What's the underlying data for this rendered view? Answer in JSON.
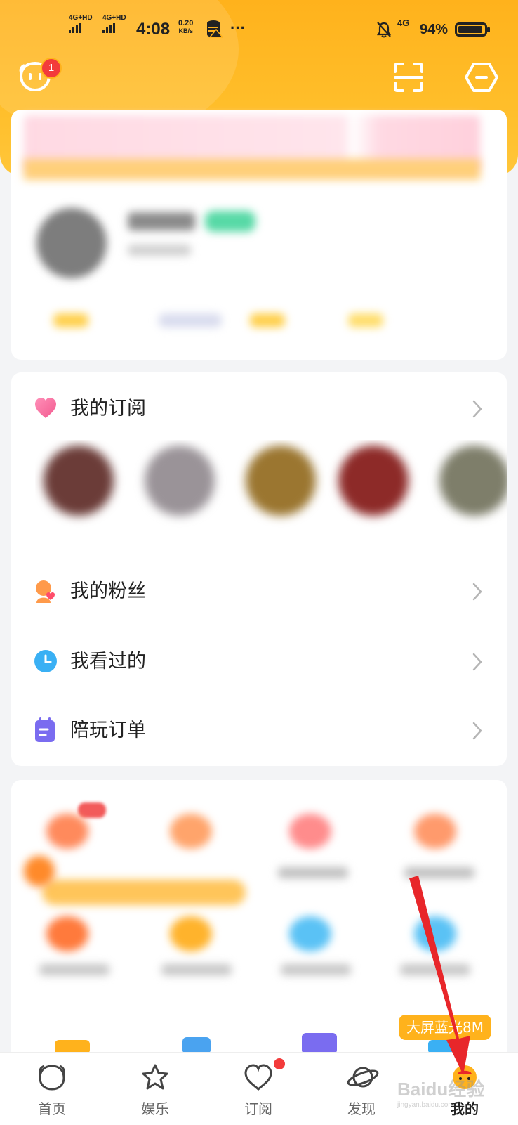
{
  "status_bar": {
    "network_1": "4G+HD",
    "network_2": "4G+HD",
    "time": "4:08",
    "speed_value": "0.20",
    "speed_unit": "KB/s",
    "dots": "···",
    "cellular": "4G",
    "battery_percent": "94%",
    "battery_level": 0.94
  },
  "header": {
    "message_badge": "1"
  },
  "menu": {
    "subscriptions": "我的订阅",
    "fans": "我的粉丝",
    "history": "我看过的",
    "orders": "陪玩订单"
  },
  "promo_tag": "大屏蓝光8M",
  "tabbar": {
    "home": "首页",
    "entertainment": "娱乐",
    "subscribe": "订阅",
    "discover": "发现",
    "mine": "我的"
  },
  "watermark": {
    "text": "Baidu经验",
    "sub": "jingyan.baidu.com"
  },
  "colors": {
    "brand_yellow": "#ffb21c",
    "badge_red": "#f33b3b",
    "arrow_red": "#e8262a"
  }
}
